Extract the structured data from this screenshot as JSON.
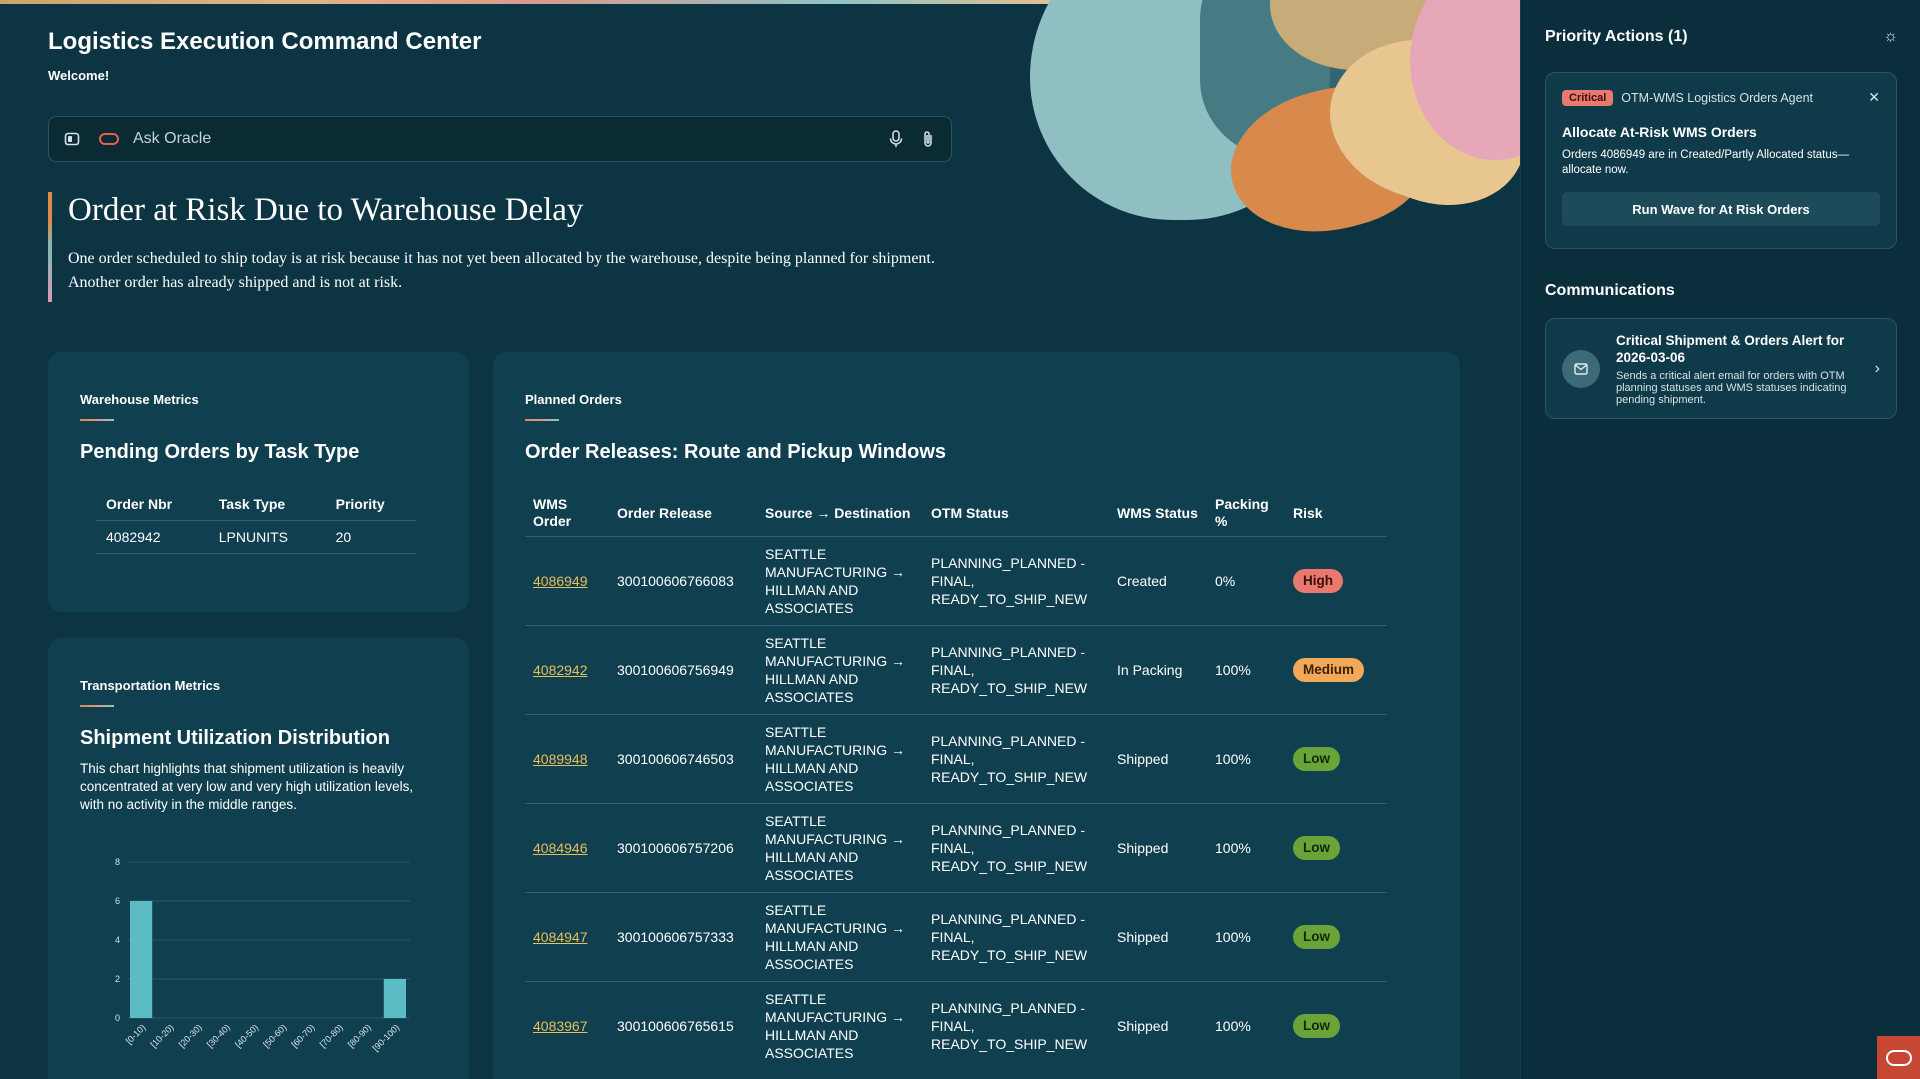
{
  "app": {
    "title": "Logistics Execution Command Center",
    "welcome": "Welcome!"
  },
  "ask": {
    "placeholder": "Ask Oracle",
    "left_icons": [
      "sidebar-toggle-icon",
      "oracle-logo-icon"
    ],
    "right_icons": [
      "microphone-icon",
      "paperclip-icon"
    ]
  },
  "hero": {
    "heading": "Order at Risk Due to Warehouse Delay",
    "text": "One order scheduled to ship today is at risk because it has not yet been allocated by the warehouse, despite being planned for shipment. Another order has already shipped and is not at risk."
  },
  "warehouse": {
    "kicker": "Warehouse Metrics",
    "heading": "Pending Orders by Task Type",
    "columns": [
      "Order Nbr",
      "Task Type",
      "Priority"
    ],
    "rows": [
      [
        "4082942",
        "LPNUNITS",
        "20"
      ]
    ]
  },
  "transport": {
    "kicker": "Transportation Metrics",
    "heading": "Shipment Utilization Distribution",
    "desc": "This chart highlights that shipment utilization is heavily concentrated at very low and very high utilization levels, with no activity in the middle ranges."
  },
  "chart_data": {
    "type": "bar",
    "categories": [
      "[0-10)",
      "[10-20)",
      "[20-30)",
      "[30-40)",
      "[40-50)",
      "[50-60)",
      "[60-70)",
      "[70-80)",
      "[80-90)",
      "[90-100)"
    ],
    "values": [
      6,
      0,
      0,
      0,
      0,
      0,
      0,
      0,
      0,
      2
    ],
    "yticks": [
      "0",
      "2",
      "4",
      "6",
      "8"
    ],
    "ylim": [
      0,
      8
    ],
    "color": "#5cbcc6",
    "grid": true
  },
  "planned": {
    "kicker": "Planned Orders",
    "heading": "Order Releases: Route and Pickup Windows",
    "columns": [
      "WMS Order",
      "Order Release",
      "Source → Destination",
      "OTM Status",
      "WMS Status",
      "Packing %",
      "Risk"
    ],
    "rows": [
      {
        "wms": "4086949",
        "release": "300100606766083",
        "route": "SEATTLE MANUFACTURING → HILLMAN AND ASSOCIATES",
        "otm": "PLANNING_PLANNED - FINAL, READY_TO_SHIP_NEW",
        "status": "Created",
        "packing": "0%",
        "risk": "High",
        "risk_level": "high"
      },
      {
        "wms": "4082942",
        "release": "300100606756949",
        "route": "SEATTLE MANUFACTURING → HILLMAN AND ASSOCIATES",
        "otm": "PLANNING_PLANNED - FINAL, READY_TO_SHIP_NEW",
        "status": "In Packing",
        "packing": "100%",
        "risk": "Medium",
        "risk_level": "medium"
      },
      {
        "wms": "4089948",
        "release": "300100606746503",
        "route": "SEATTLE MANUFACTURING → HILLMAN AND ASSOCIATES",
        "otm": "PLANNING_PLANNED - FINAL, READY_TO_SHIP_NEW",
        "status": "Shipped",
        "packing": "100%",
        "risk": "Low",
        "risk_level": "low"
      },
      {
        "wms": "4084946",
        "release": "300100606757206",
        "route": "SEATTLE MANUFACTURING → HILLMAN AND ASSOCIATES",
        "otm": "PLANNING_PLANNED - FINAL, READY_TO_SHIP_NEW",
        "status": "Shipped",
        "packing": "100%",
        "risk": "Low",
        "risk_level": "low"
      },
      {
        "wms": "4084947",
        "release": "300100606757333",
        "route": "SEATTLE MANUFACTURING → HILLMAN AND ASSOCIATES",
        "otm": "PLANNING_PLANNED - FINAL, READY_TO_SHIP_NEW",
        "status": "Shipped",
        "packing": "100%",
        "risk": "Low",
        "risk_level": "low"
      },
      {
        "wms": "4083967",
        "release": "300100606765615",
        "route": "SEATTLE MANUFACTURING → HILLMAN AND ASSOCIATES",
        "otm": "PLANNING_PLANNED - FINAL, READY_TO_SHIP_NEW",
        "status": "Shipped",
        "packing": "100%",
        "risk": "Low",
        "risk_level": "low"
      }
    ]
  },
  "panel": {
    "title": "Priority Actions (1)",
    "action": {
      "badge": "Critical",
      "agent": "OTM-WMS Logistics Orders Agent",
      "heading": "Allocate At-Risk WMS Orders",
      "desc": "Orders 4086949 are in Created/Partly Allocated status—allocate now.",
      "button": "Run Wave for At Risk Orders"
    },
    "comm_title": "Communications",
    "comm": {
      "title": "Critical Shipment & Orders Alert for 2026-03-06",
      "desc": "Sends a critical alert email for orders with OTM planning statuses and WMS statuses indicating pending shipment."
    }
  }
}
